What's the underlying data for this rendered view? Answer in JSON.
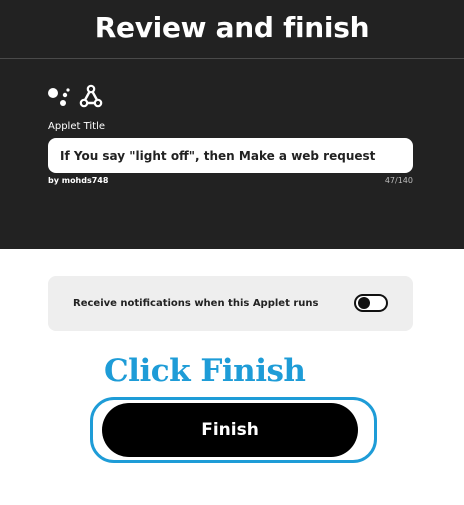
{
  "header": {
    "title": "Review and finish"
  },
  "applet": {
    "trigger_icon": "google-assistant-icon",
    "action_icon": "webhooks-icon",
    "title_label": "Applet Title",
    "title_value": "If You say \"light off\", then Make a web request",
    "byline": "by mohds748",
    "char_count": "47/140"
  },
  "notifications": {
    "label": "Receive notifications when this Applet runs",
    "enabled": false
  },
  "annotation": {
    "text": "Click Finish",
    "color": "#1e9cd7"
  },
  "finish_button": {
    "label": "Finish"
  },
  "colors": {
    "header_bg": "#222222",
    "card_bg": "#eeeeee",
    "button_bg": "#000000"
  }
}
